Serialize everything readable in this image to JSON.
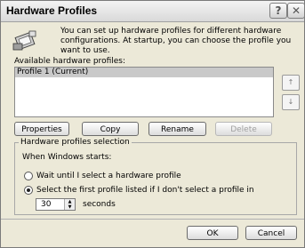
{
  "window": {
    "title": "Hardware Profiles"
  },
  "titlebar": {
    "help_glyph": "?",
    "close_glyph": "✕"
  },
  "intro": {
    "text": "You can set up hardware profiles for different hardware configurations.  At startup, you can choose the profile you want to use."
  },
  "profiles": {
    "label": "Available hardware profiles:",
    "items": [
      "Profile 1 (Current)"
    ],
    "selected_index": 0,
    "up_glyph": "↑",
    "down_glyph": "↓"
  },
  "actions": {
    "properties": "Properties",
    "copy": "Copy",
    "rename": "Rename",
    "delete": "Delete"
  },
  "selection": {
    "group_title": "Hardware profiles selection",
    "when_label": "When Windows starts:",
    "wait_label": "Wait until I select a hardware profile",
    "first_label": "Select the first profile listed if I don't select a profile in",
    "selected_option": "first",
    "seconds_value": "30",
    "seconds_label": "seconds"
  },
  "footer": {
    "ok": "OK",
    "cancel": "Cancel"
  },
  "icons": {
    "hardware": "hardware-profile-icon"
  }
}
